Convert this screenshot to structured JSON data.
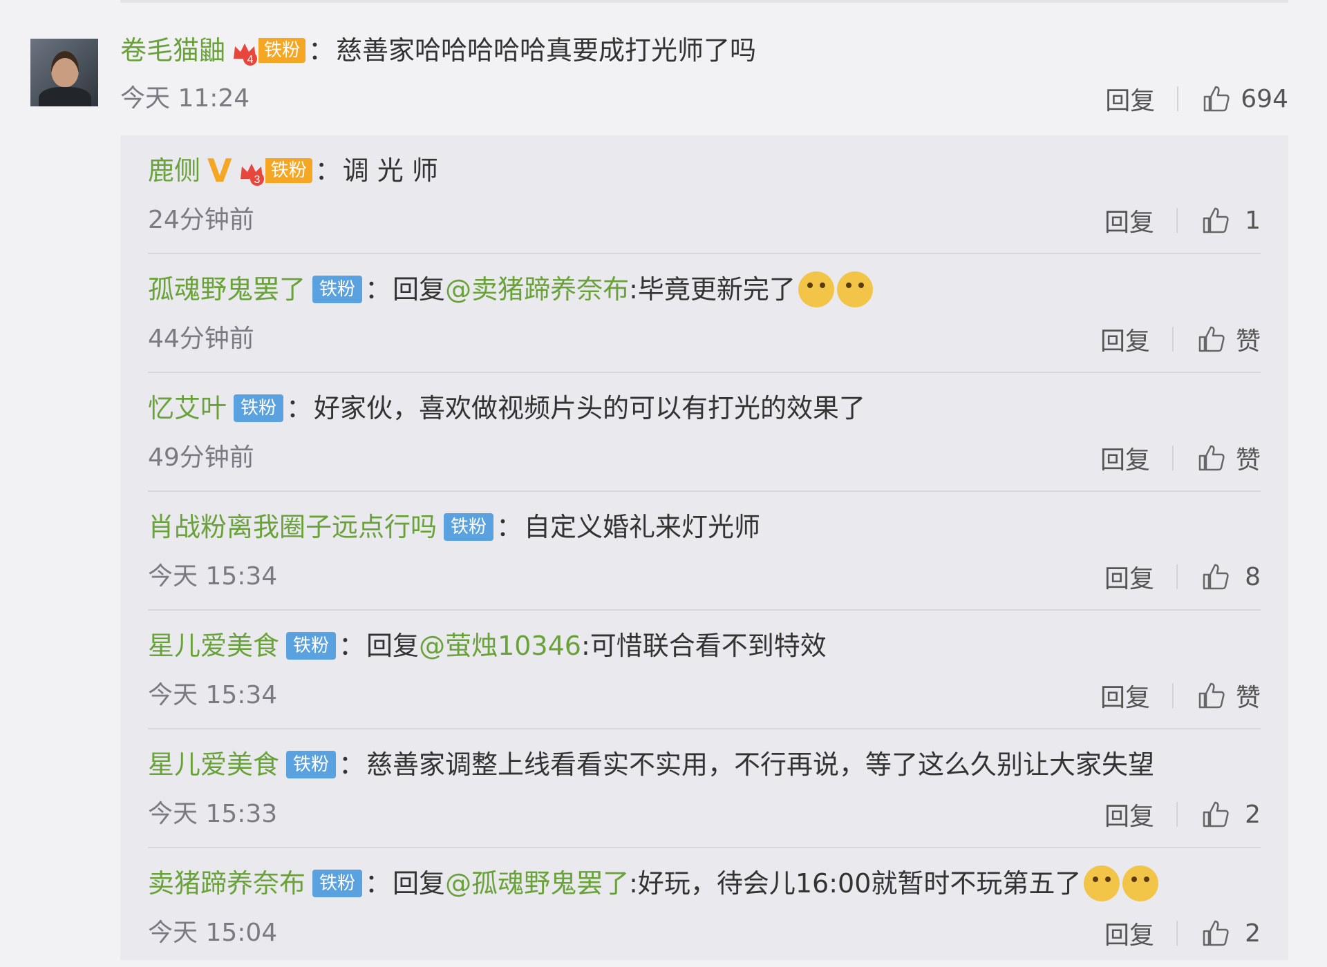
{
  "main_comment": {
    "username": "卷毛猫鼬",
    "badge_label": "铁粉",
    "badge_level": "4",
    "text": "慈善家哈哈哈哈哈真要成打光师了吗",
    "time": "今天 11:24",
    "reply_label": "回复",
    "like_count": "694"
  },
  "replies": [
    {
      "username": "鹿侧",
      "verified": "V",
      "badge_label": "铁粉",
      "badge_level": "3",
      "text": "调 光 师",
      "time": "24分钟前",
      "reply_label": "回复",
      "like_count": "1"
    },
    {
      "username": "孤魂野鬼罢了",
      "badge_label": "铁粉",
      "prefix": "回复",
      "mention": "@卖猪蹄养奈布",
      "text": ":毕竟更新完了",
      "time": "44分钟前",
      "reply_label": "回复",
      "like_count": "赞"
    },
    {
      "username": "忆艾叶",
      "badge_label": "铁粉",
      "text": "好家伙，喜欢做视频片头的可以有打光的效果了",
      "time": "49分钟前",
      "reply_label": "回复",
      "like_count": "赞"
    },
    {
      "username": "肖战粉离我圈子远点行吗",
      "badge_label": "铁粉",
      "text": "自定义婚礼来灯光师",
      "time": "今天 15:34",
      "reply_label": "回复",
      "like_count": "8"
    },
    {
      "username": "星儿爱美食",
      "badge_label": "铁粉",
      "prefix": "回复",
      "mention": "@萤烛10346",
      "text": ":可惜联合看不到特效",
      "time": "今天 15:34",
      "reply_label": "回复",
      "like_count": "赞"
    },
    {
      "username": "星儿爱美食",
      "badge_label": "铁粉",
      "text": "慈善家调整上线看看实不实用，不行再说，等了这么久别让大家失望",
      "time": "今天 15:33",
      "reply_label": "回复",
      "like_count": "2"
    },
    {
      "username": "卖猪蹄养奈布",
      "badge_label": "铁粉",
      "prefix": "回复",
      "mention": "@孤魂野鬼罢了",
      "text": ":好玩，待会儿16:00就暂时不玩第五了",
      "time": "今天 15:04",
      "reply_label": "回复",
      "like_count": "2"
    }
  ],
  "icons": {
    "like": "thumbs-up-icon",
    "emoji": "dog-face-emoji-icon",
    "crown": "crown-icon"
  },
  "colors": {
    "username": "#6aa23a",
    "fan_badge": "#5aa1e0",
    "crown_badge": "#f5a623",
    "background": "#f2f2f5",
    "reply_background": "#e9e9ee"
  }
}
